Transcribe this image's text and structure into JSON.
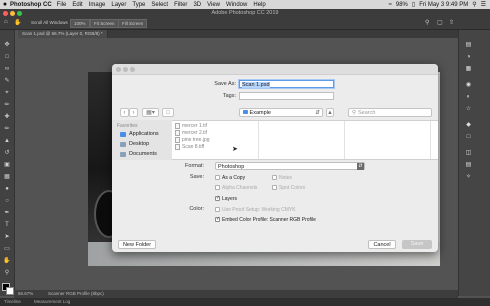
{
  "menubar": {
    "app": "Photoshop CC",
    "items": [
      "File",
      "Edit",
      "Image",
      "Layer",
      "Type",
      "Select",
      "Filter",
      "3D",
      "View",
      "Window",
      "Help"
    ],
    "battery": "98%",
    "clock": "Fri May 3  9:49 PM"
  },
  "optionsbar": {
    "title": "Adobe Photoshop CC 2019",
    "buttons": [
      "Scroll All Windows",
      "100%",
      "Fit Screen",
      "Fill Screen"
    ]
  },
  "document": {
    "tab": "Scan 1.psd @ 66.7% (Layer 0, RGB/8) *",
    "zoom": "66.67%",
    "profile": "Scanner RGB Profile (8bpc)"
  },
  "bottombar": {
    "items": [
      "Timeline",
      "Measurement Log"
    ]
  },
  "dialog": {
    "save_as_label": "Save As:",
    "save_as_value": "Scan 1.psd",
    "tags_label": "Tags:",
    "location": "Example",
    "search_placeholder": "Search",
    "favorites_label": "Favorites",
    "sidebar": [
      "Applications",
      "Desktop",
      "Documents"
    ],
    "files": [
      "mercer 1.tif",
      "mercer 2.tif",
      "pine tree.jpg",
      "Scan 8.tiff"
    ],
    "format_label": "Format:",
    "format_value": "Photoshop",
    "save_label": "Save:",
    "save_options": [
      {
        "label": "As a Copy",
        "checked": false,
        "enabled": true
      },
      {
        "label": "Notes",
        "checked": false,
        "enabled": false
      },
      {
        "label": "Alpha Channels",
        "checked": false,
        "enabled": false
      },
      {
        "label": "Spot Colors",
        "checked": false,
        "enabled": false
      },
      {
        "label": "Layers",
        "checked": true,
        "enabled": true
      }
    ],
    "color_label": "Color:",
    "color_options": [
      {
        "label": "Use Proof Setup:  Working CMYK",
        "checked": false,
        "enabled": false
      },
      {
        "label": "Embed Color Profile:  Scanner RGB Profile",
        "checked": true,
        "enabled": true
      }
    ],
    "new_folder": "New Folder",
    "cancel": "Cancel",
    "save": "Save"
  }
}
